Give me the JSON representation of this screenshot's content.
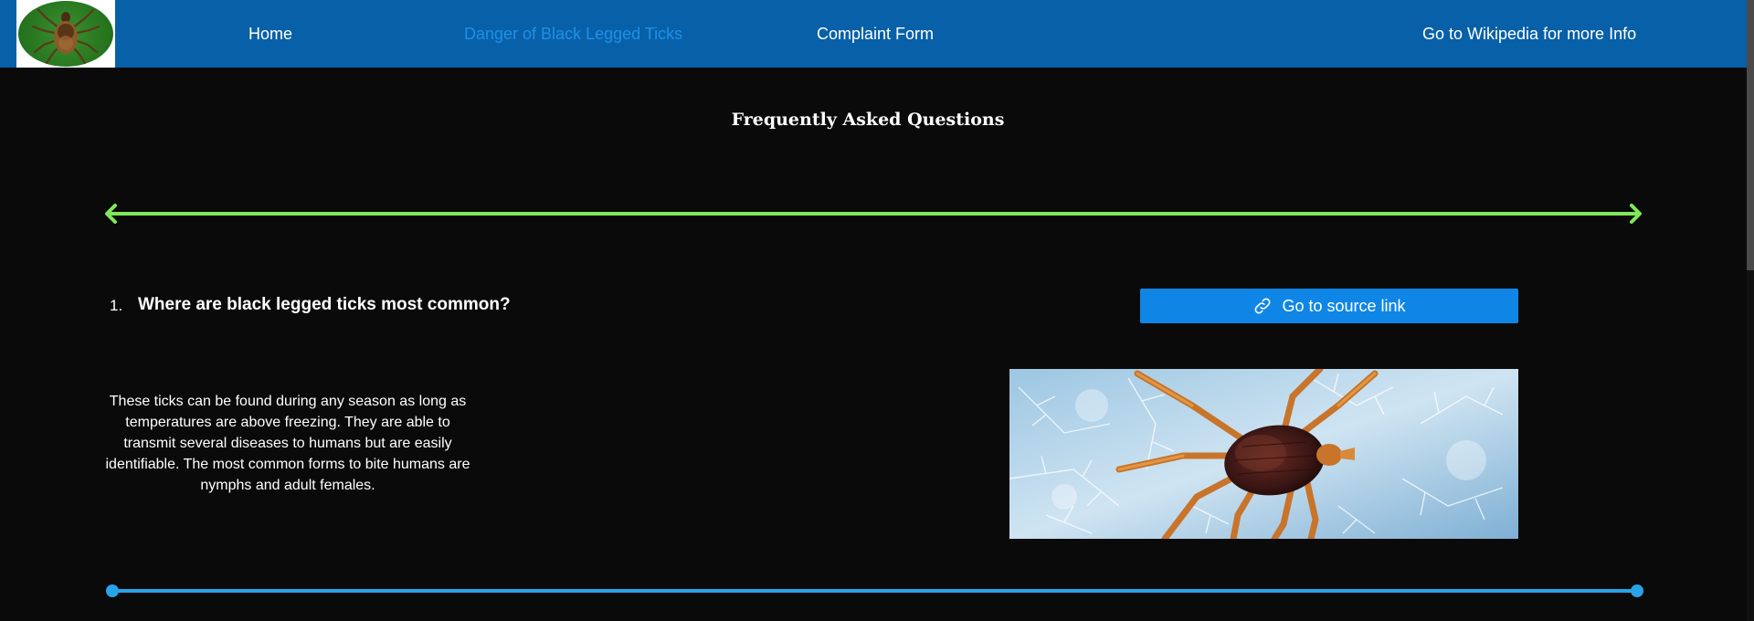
{
  "nav": {
    "logo_icon": "tick-logo-icon",
    "items": [
      {
        "label": "Home"
      },
      {
        "label": "Danger of Black Legged Ticks",
        "active": true
      },
      {
        "label": "Complaint Form"
      },
      {
        "label": "Go to Wikipedia for more Info"
      }
    ]
  },
  "faq": {
    "title": "Frequently Asked Questions",
    "question": {
      "number": "1.",
      "text": "Where are black legged ticks most common?"
    },
    "source_button": {
      "label": "Go to source link",
      "icon": "link-icon"
    },
    "answer": "These ticks can be found during any season as long as temperatures are above freezing. They are able to transmit several diseases to humans but are easily identifiable. The most common forms to bite humans are nymphs and adult females."
  },
  "colors": {
    "nav_background": "#0860a8",
    "active_nav": "#1e90e8",
    "page_background": "#0a0a0a",
    "green_divider": "#7fe85a",
    "blue_divider": "#29a3e8",
    "button_background": "#0f86e6"
  }
}
